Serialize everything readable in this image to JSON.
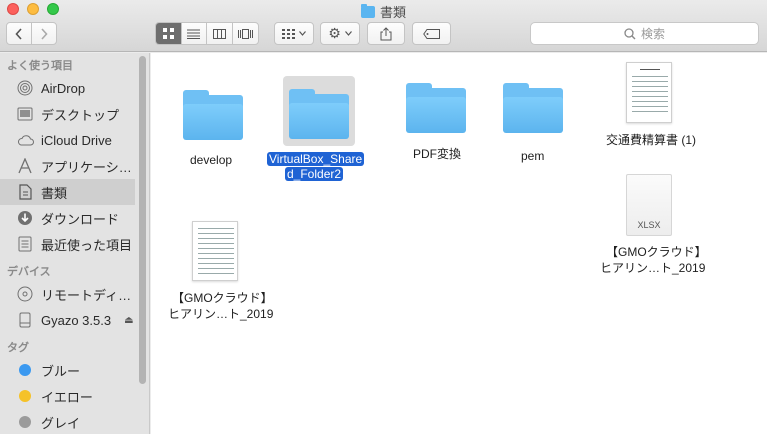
{
  "window": {
    "title": "書類"
  },
  "toolbar": {
    "back_icon": "chevron-left-icon",
    "forward_icon": "chevron-right-icon",
    "view_modes": [
      "icon-view",
      "list-view",
      "column-view",
      "cover-flow-view"
    ],
    "search_placeholder": "検索"
  },
  "sidebar": {
    "sections": [
      {
        "header": "よく使う項目",
        "items": [
          {
            "label": "AirDrop",
            "icon": "airdrop-icon"
          },
          {
            "label": "デスクトップ",
            "icon": "desktop-icon"
          },
          {
            "label": "iCloud Drive",
            "icon": "cloud-icon"
          },
          {
            "label": "アプリケーシ…",
            "icon": "applications-icon"
          },
          {
            "label": "書類",
            "icon": "documents-icon",
            "selected": true
          },
          {
            "label": "ダウンロード",
            "icon": "downloads-icon"
          },
          {
            "label": "最近使った項目",
            "icon": "recents-icon"
          }
        ]
      },
      {
        "header": "デバイス",
        "items": [
          {
            "label": "リモートディ…",
            "icon": "remote-disc-icon"
          },
          {
            "label": "Gyazo 3.5.3",
            "icon": "disk-icon",
            "eject": true
          }
        ]
      },
      {
        "header": "タグ",
        "items": [
          {
            "label": "ブルー",
            "color": "#3b99f0"
          },
          {
            "label": "イエロー",
            "color": "#f5c228"
          },
          {
            "label": "グレイ",
            "color": "#9b9b9b"
          }
        ]
      }
    ]
  },
  "files": [
    {
      "name": "develop",
      "kind": "folder"
    },
    {
      "name_line1": "VirtualBox_Share",
      "name_line2": "d_Folder2",
      "kind": "folder",
      "selected": true
    },
    {
      "name": "PDF変換",
      "kind": "folder"
    },
    {
      "name": "pem",
      "kind": "folder"
    },
    {
      "name": "交通費精算書 (1)",
      "kind": "document"
    },
    {
      "name_line1": "【GMOクラウド】",
      "name_line2": "ヒアリン…ト_2019",
      "kind": "xlsx",
      "badge": "XLSX"
    },
    {
      "name_line1": "【GMOクラウド】",
      "name_line2": "ヒアリン…ト_2019",
      "kind": "document"
    }
  ]
}
